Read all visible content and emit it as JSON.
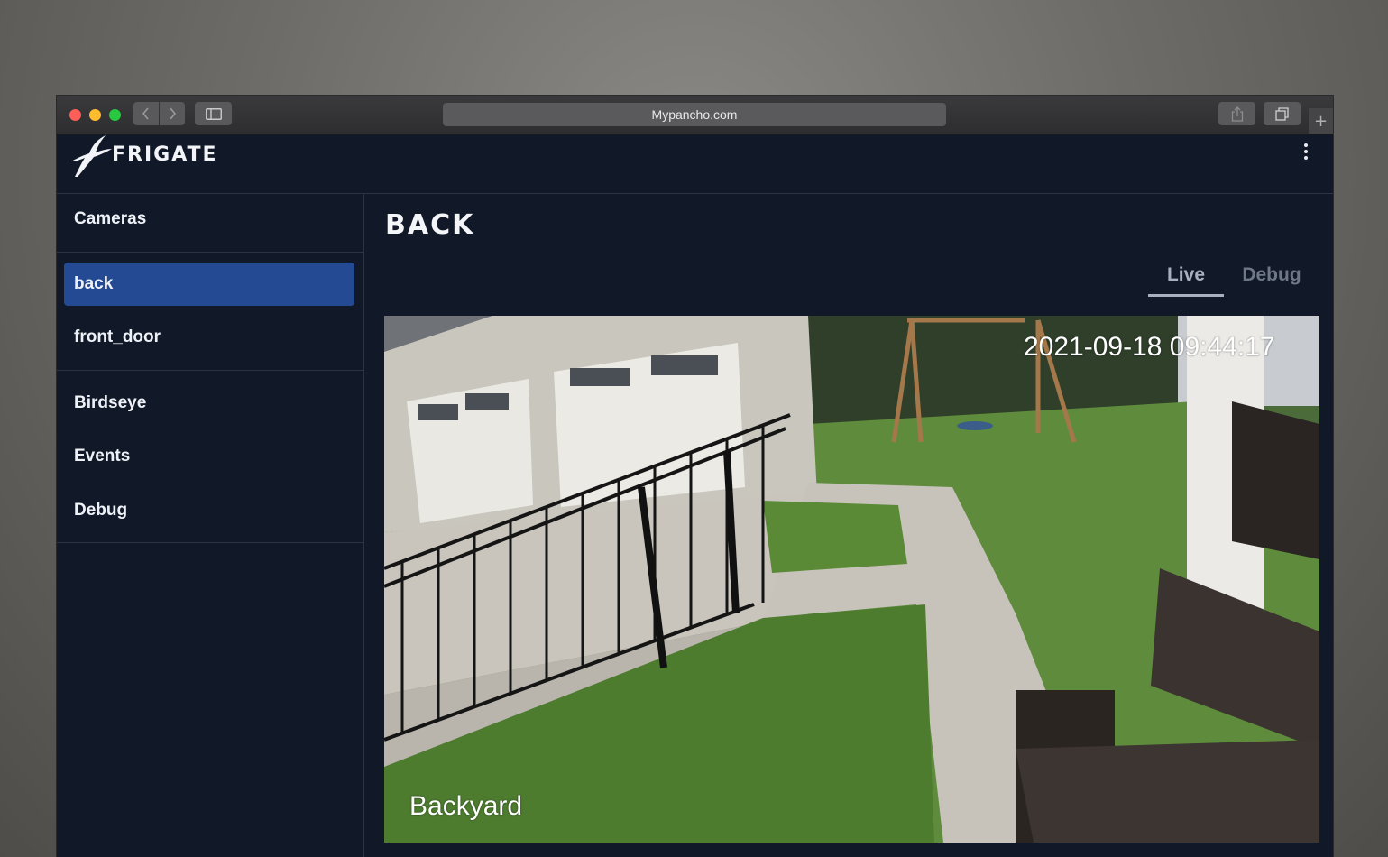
{
  "browser": {
    "url": "Mypancho.com",
    "new_tab_label": "+"
  },
  "app": {
    "brand": "FRIGATE"
  },
  "sidebar": {
    "cameras_heading": "Cameras",
    "cameras": [
      {
        "label": "back",
        "active": true
      },
      {
        "label": "front_door",
        "active": false
      }
    ],
    "nav": [
      {
        "label": "Birdseye"
      },
      {
        "label": "Events"
      },
      {
        "label": "Debug"
      }
    ]
  },
  "main": {
    "title": "BACK",
    "tabs": [
      {
        "label": "Live",
        "active": true
      },
      {
        "label": "Debug",
        "active": false
      }
    ],
    "feed": {
      "timestamp": "2021-09-18 09:44:17",
      "camera_label": "Backyard"
    }
  },
  "colors": {
    "app_background": "#111827",
    "active_item": "#244a94"
  }
}
